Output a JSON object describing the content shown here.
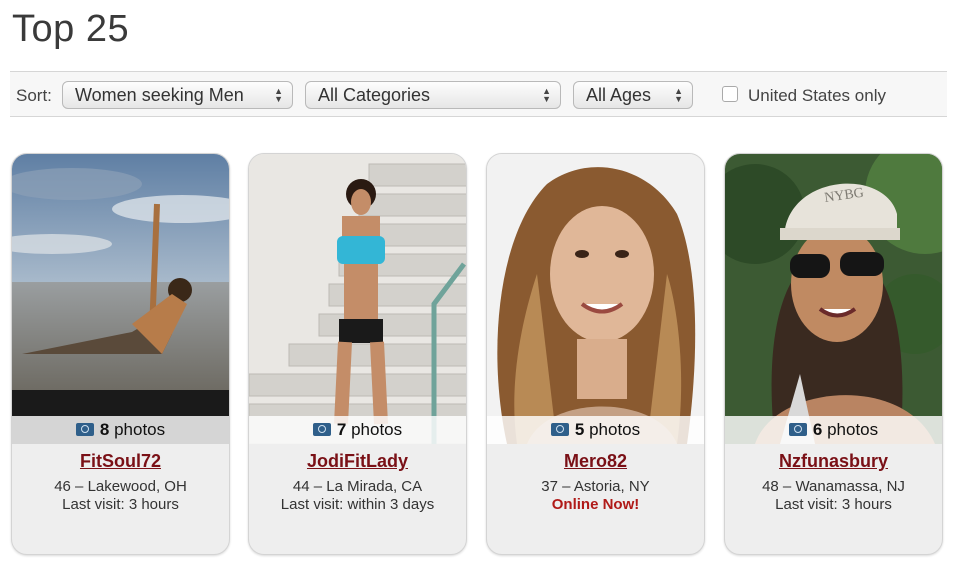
{
  "page": {
    "title": "Top 25"
  },
  "filters": {
    "sort_label": "Sort:",
    "seeking": "Women seeking Men",
    "category": "All Categories",
    "ages": "All Ages",
    "us_only_label": "United States only",
    "us_only_checked": false
  },
  "profiles": [
    {
      "photos_count": "8",
      "photos_word": "photos",
      "username": "FitSoul72",
      "location": "46 – Lakewood, OH",
      "last_visit": "Last visit: 3 hours"
    },
    {
      "photos_count": "7",
      "photos_word": "photos",
      "username": "JodiFitLady",
      "location": "44 – La Mirada, CA",
      "last_visit": "Last visit: within 3 days"
    },
    {
      "photos_count": "5",
      "photos_word": "photos",
      "username": "Mero82",
      "location": "37 – Astoria, NY",
      "last_visit": "Online Now!"
    },
    {
      "photos_count": "6",
      "photos_word": "photos",
      "username": "Nzfunasbury",
      "location": "48 – Wanamassa, NJ",
      "last_visit": "Last visit: 3 hours"
    }
  ],
  "colors": {
    "username": "#7a1016",
    "online": "#b01a18",
    "card_bg": "#eeeeee"
  },
  "icons": {
    "photo_count": "camera-icon",
    "select_arrows": "updown-arrows-icon"
  },
  "photo_captions": {
    "hat_text": "NYBG"
  }
}
